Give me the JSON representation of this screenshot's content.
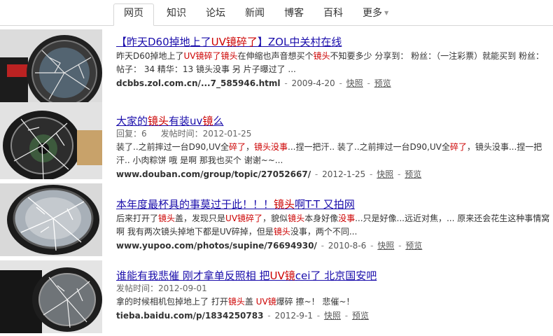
{
  "nav": {
    "tabs": [
      {
        "label": "网页"
      },
      {
        "label": "知识"
      },
      {
        "label": "论坛"
      },
      {
        "label": "新闻"
      },
      {
        "label": "博客"
      },
      {
        "label": "百科"
      },
      {
        "label": "更多"
      }
    ],
    "active": "网页"
  },
  "results": [
    {
      "title_parts": [
        {
          "t": "【昨天D60掉地上了"
        },
        {
          "t": "UV镜碎了",
          "hl": true
        },
        {
          "t": "】ZOL中关村在线"
        }
      ],
      "meta": [],
      "snippet_parts": [
        {
          "t": "昨天D60掉地上了"
        },
        {
          "t": "UV镜碎了镜头",
          "hl": true
        },
        {
          "t": "在伸缩也声音想买个"
        },
        {
          "t": "镜头",
          "hl": true
        },
        {
          "t": "不知要多少 分享到： 粉丝：（一注彩票）就能买到 粉丝： 帖子： 34 精华：13 镜头没事 另 片子曝过了 ..."
        }
      ],
      "url": "dcbbs.zol.com.cn/...7_585946.html",
      "date": "2009-4-20",
      "cache": "快照",
      "preview": "预览"
    },
    {
      "title_parts": [
        {
          "t": "大家的"
        },
        {
          "t": "镜头",
          "hl": true
        },
        {
          "t": "有装uv"
        },
        {
          "t": "镜",
          "hl": true
        },
        {
          "t": "么"
        }
      ],
      "meta": [
        "回复：6",
        "发帖时间：2012-01-25"
      ],
      "snippet_parts": [
        {
          "t": "装了..之前摔过一台D90,UV全"
        },
        {
          "t": "碎了",
          "hl": true
        },
        {
          "t": "，"
        },
        {
          "t": "镜头没事",
          "hl": true
        },
        {
          "t": "...捏一把汗.. 装了..之前摔过一台D90,UV全"
        },
        {
          "t": "碎了",
          "hl": true
        },
        {
          "t": "，镜头没事...捏一把汗.. 小肉粽饼 哦 是啊 那我也买个 谢谢~~..."
        }
      ],
      "url": "www.douban.com/group/topic/27052667/",
      "date": "2012-1-25",
      "cache": "快照",
      "preview": "预览"
    },
    {
      "title_parts": [
        {
          "t": "本年度最杯具的事莫过于此！！！"
        },
        {
          "t": "镜头",
          "hl": true
        },
        {
          "t": "啊T-T 又拍网"
        }
      ],
      "meta": [],
      "snippet_parts": [
        {
          "t": "后来打开了"
        },
        {
          "t": "镜头",
          "hl": true
        },
        {
          "t": "盖，发现只是"
        },
        {
          "t": "UV镜碎了",
          "hl": true
        },
        {
          "t": "，貌似"
        },
        {
          "t": "镜头",
          "hl": true
        },
        {
          "t": "本身好像"
        },
        {
          "t": "没事",
          "hl": true
        },
        {
          "t": "...只是好像...远近对焦，... 原来还会花生这种事情窝啊 我有两次镜头掉地下都是UV碎掉，但是"
        },
        {
          "t": "镜头",
          "hl": true
        },
        {
          "t": "没事，两个不同..."
        }
      ],
      "url": "www.yupoo.com/photos/supine/76694930/",
      "date": "2010-8-6",
      "cache": "快照",
      "preview": "预览"
    },
    {
      "title_parts": [
        {
          "t": "谁能有我悲催 刚才拿单反照相 把"
        },
        {
          "t": "UV镜",
          "hl": true
        },
        {
          "t": "cei了 北京国安吧"
        }
      ],
      "meta": [
        "发帖时间：2012-09-01"
      ],
      "snippet_parts": [
        {
          "t": "拿的时候相机包掉地上了 打开"
        },
        {
          "t": "镜头",
          "hl": true
        },
        {
          "t": "盖 "
        },
        {
          "t": "UV镜",
          "hl": true
        },
        {
          "t": "爆碎 擦~！ 悲催~！"
        }
      ],
      "url": "tieba.baidu.com/p/1834250783",
      "date": "2012-9-1",
      "cache": "快照",
      "preview": "预览"
    }
  ]
}
